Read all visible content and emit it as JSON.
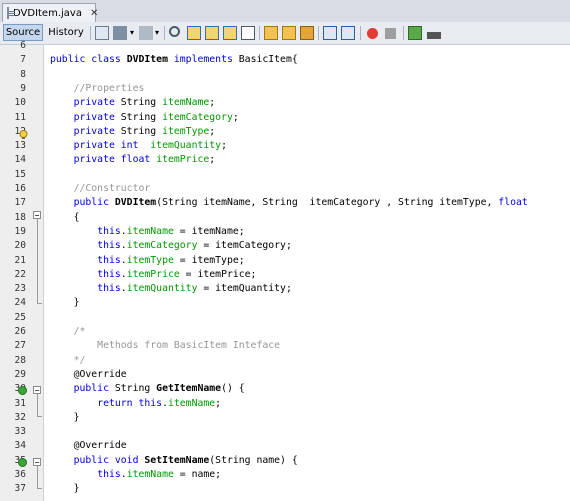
{
  "tab": {
    "title": "DVDItem.java",
    "close": "✕"
  },
  "toolbar": {
    "source_label": "Source",
    "history_label": "History"
  },
  "lines": [
    {
      "n": "6",
      "html": ""
    },
    {
      "n": "7",
      "html": "<span class=\"kw\">public class</span> <span class=\"bold\">DVDItem</span> <span class=\"kw\">implements</span> BasicItem{"
    },
    {
      "n": "8",
      "html": ""
    },
    {
      "n": "9",
      "html": "    <span class=\"cm\">//Properties</span>"
    },
    {
      "n": "10",
      "html": "    <span class=\"kw\">private</span> String <span class=\"fd\">itemName</span>;"
    },
    {
      "n": "11",
      "html": "    <span class=\"kw\">private</span> String <span class=\"fd\">itemCategory</span>;"
    },
    {
      "n": "12",
      "html": "    <span class=\"kw\">private</span> String <span class=\"fd\">itemType</span>;"
    },
    {
      "n": "13",
      "html": "    <span class=\"kw\">private int</span>  <span class=\"fd\">itemQuantity</span>;"
    },
    {
      "n": "14",
      "html": "    <span class=\"kw\">private float</span> <span class=\"fd\">itemPrice</span>;"
    },
    {
      "n": "15",
      "html": ""
    },
    {
      "n": "16",
      "html": "    <span class=\"cm\">//Constructor</span>"
    },
    {
      "n": "17",
      "html": "    <span class=\"kw\">public</span> <span class=\"bold\">DVDItem</span>(String itemName, String  itemCategory , String itemType, <span class=\"kw\">float</span>"
    },
    {
      "n": "18",
      "html": "    {"
    },
    {
      "n": "19",
      "html": "        <span class=\"kw\">this</span>.<span class=\"fd\">itemName</span> = itemName;"
    },
    {
      "n": "20",
      "html": "        <span class=\"kw\">this</span>.<span class=\"fd\">itemCategory</span> = itemCategory;"
    },
    {
      "n": "21",
      "html": "        <span class=\"kw\">this</span>.<span class=\"fd\">itemType</span> = itemType;"
    },
    {
      "n": "22",
      "html": "        <span class=\"kw\">this</span>.<span class=\"fd\">itemPrice</span> = itemPrice;"
    },
    {
      "n": "23",
      "html": "        <span class=\"kw\">this</span>.<span class=\"fd\">itemQuantity</span> = itemQuantity;"
    },
    {
      "n": "24",
      "html": "    }"
    },
    {
      "n": "25",
      "html": ""
    },
    {
      "n": "26",
      "html": "    <span class=\"cm\">/*</span>"
    },
    {
      "n": "27",
      "html": "<span class=\"cm\">        Methods from BasicItem Inteface</span>"
    },
    {
      "n": "28",
      "html": "    <span class=\"cm\">*/</span>"
    },
    {
      "n": "29",
      "html": "    @Override"
    },
    {
      "n": "30",
      "html": "    <span class=\"kw\">public</span> String <span class=\"bold\">GetItemName</span>() {"
    },
    {
      "n": "31",
      "html": "        <span class=\"kw\">return this</span>.<span class=\"fd\">itemName</span>;"
    },
    {
      "n": "32",
      "html": "    }"
    },
    {
      "n": "33",
      "html": ""
    },
    {
      "n": "34",
      "html": "    @Override"
    },
    {
      "n": "35",
      "html": "    <span class=\"kw\">public void</span> <span class=\"bold\">SetItemName</span>(String name) {"
    },
    {
      "n": "36",
      "html": "        <span class=\"kw\">this</span>.<span class=\"fd\">itemName</span> = name;"
    },
    {
      "n": "37",
      "html": "    }"
    }
  ],
  "colors": {
    "keyword": "#0000e6",
    "comment": "#969696",
    "field": "#009900"
  }
}
